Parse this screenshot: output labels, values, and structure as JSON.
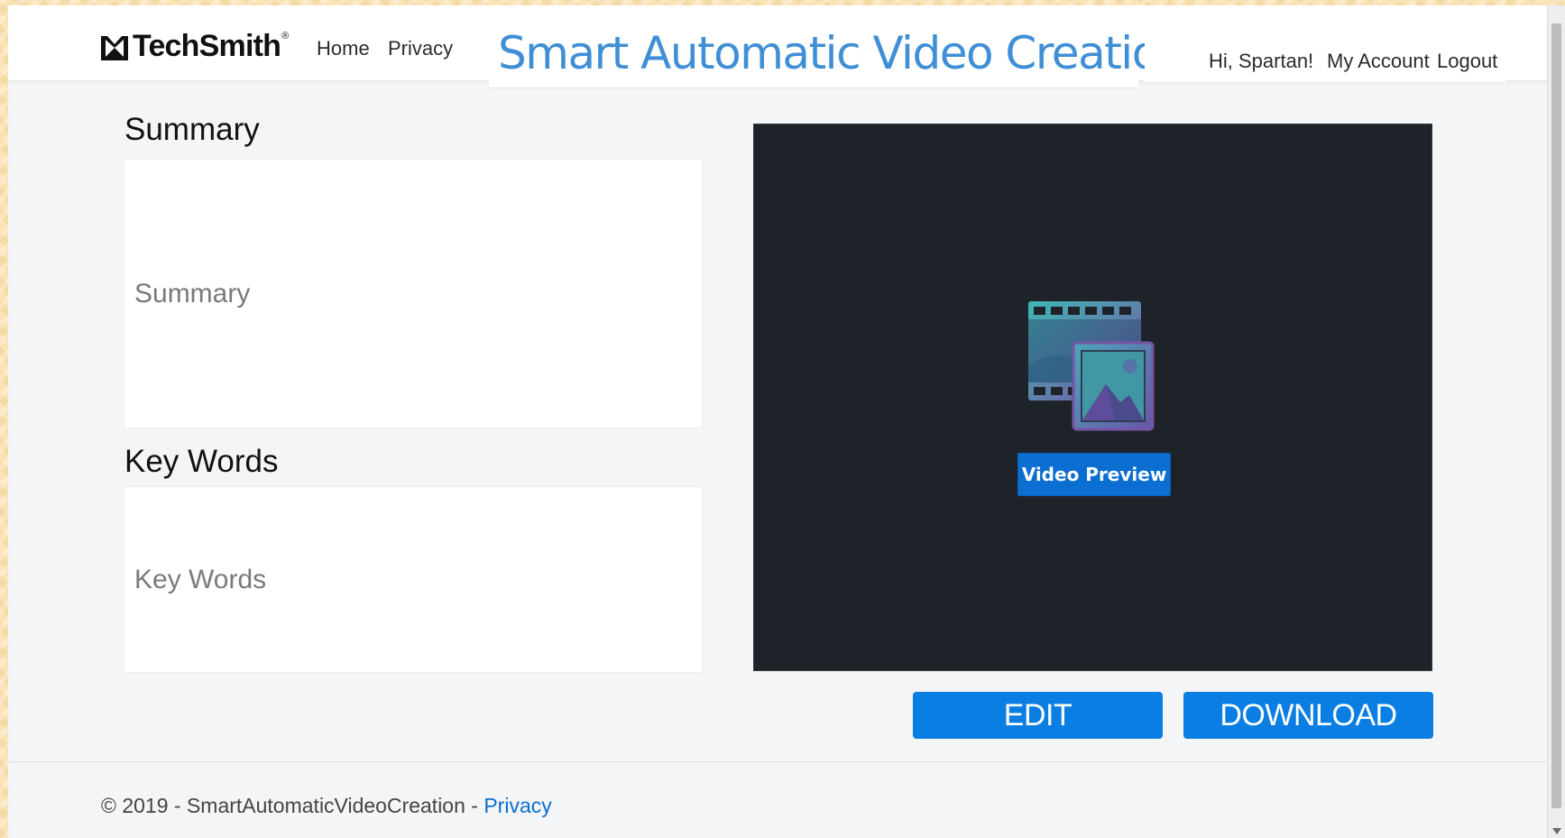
{
  "header": {
    "brand": "TechSmith",
    "brand_reg": "®",
    "nav": {
      "home": "Home",
      "privacy": "Privacy"
    },
    "site_title": "Smart Automatic Video Creation",
    "greeting": "Hi, Spartan!",
    "my_account": "My Account",
    "logout": "Logout"
  },
  "summary": {
    "heading": "Summary",
    "placeholder": "Summary"
  },
  "keywords": {
    "heading": "Key Words",
    "placeholder": "Key Words"
  },
  "preview": {
    "badge": "Video Preview",
    "icon": "video-image-icon"
  },
  "actions": {
    "edit": "EDIT",
    "download": "DOWNLOAD"
  },
  "footer": {
    "copyright": "© 2019 - SmartAutomaticVideoCreation - ",
    "privacy": "Privacy"
  },
  "colors": {
    "title_blue": "#3f8fd6",
    "button_blue": "#0a7ee3",
    "link_blue": "#0a6fd1",
    "preview_bg": "#1e232a",
    "page_bg": "#f4f5f6"
  }
}
